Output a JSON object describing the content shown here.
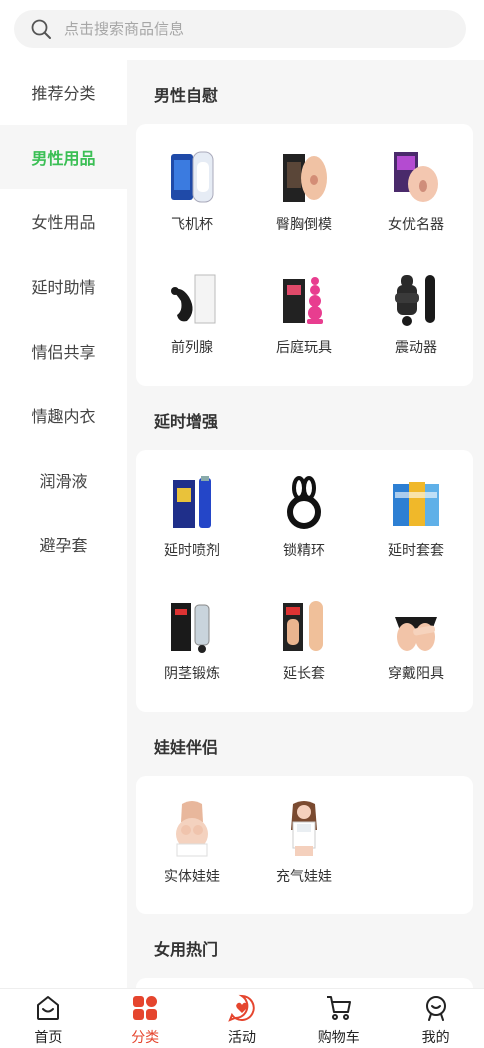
{
  "search": {
    "placeholder": "点击搜索商品信息"
  },
  "sidebar": {
    "items": [
      {
        "label": "推荐分类"
      },
      {
        "label": "男性用品"
      },
      {
        "label": "女性用品"
      },
      {
        "label": "延时助情"
      },
      {
        "label": "情侣共享"
      },
      {
        "label": "情趣内衣"
      },
      {
        "label": "润滑液"
      },
      {
        "label": "避孕套"
      }
    ],
    "active_index": 1
  },
  "sections": [
    {
      "title": "男性自慰",
      "products": [
        {
          "label": "飞机杯",
          "icon": "masturbator-cup-icon"
        },
        {
          "label": "臀胸倒模",
          "icon": "body-mold-icon"
        },
        {
          "label": "女优名器",
          "icon": "sleeve-icon"
        },
        {
          "label": "前列腺",
          "icon": "prostate-massager-icon"
        },
        {
          "label": "后庭玩具",
          "icon": "anal-toy-icon"
        },
        {
          "label": "震动器",
          "icon": "vibrator-icon"
        }
      ]
    },
    {
      "title": "延时增强",
      "products": [
        {
          "label": "延时喷剂",
          "icon": "spray-icon"
        },
        {
          "label": "锁精环",
          "icon": "ring-icon"
        },
        {
          "label": "延时套套",
          "icon": "condom-box-icon"
        },
        {
          "label": "阴茎锻炼",
          "icon": "pump-icon"
        },
        {
          "label": "延长套",
          "icon": "extender-sleeve-icon"
        },
        {
          "label": "穿戴阳具",
          "icon": "strap-on-icon"
        }
      ]
    },
    {
      "title": "娃娃伴侣",
      "products": [
        {
          "label": "实体娃娃",
          "icon": "doll-icon"
        },
        {
          "label": "充气娃娃",
          "icon": "inflatable-doll-icon"
        }
      ]
    },
    {
      "title": "女用热门",
      "products": []
    }
  ],
  "tabbar": {
    "items": [
      {
        "label": "首页",
        "icon": "home-icon"
      },
      {
        "label": "分类",
        "icon": "category-icon"
      },
      {
        "label": "活动",
        "icon": "activity-heart-icon"
      },
      {
        "label": "购物车",
        "icon": "cart-icon"
      },
      {
        "label": "我的",
        "icon": "profile-icon"
      }
    ],
    "active_index": 1,
    "active_color": "#e5452e"
  },
  "colors": {
    "accent_green": "#3bbf55",
    "background": "#f6f6f6"
  }
}
